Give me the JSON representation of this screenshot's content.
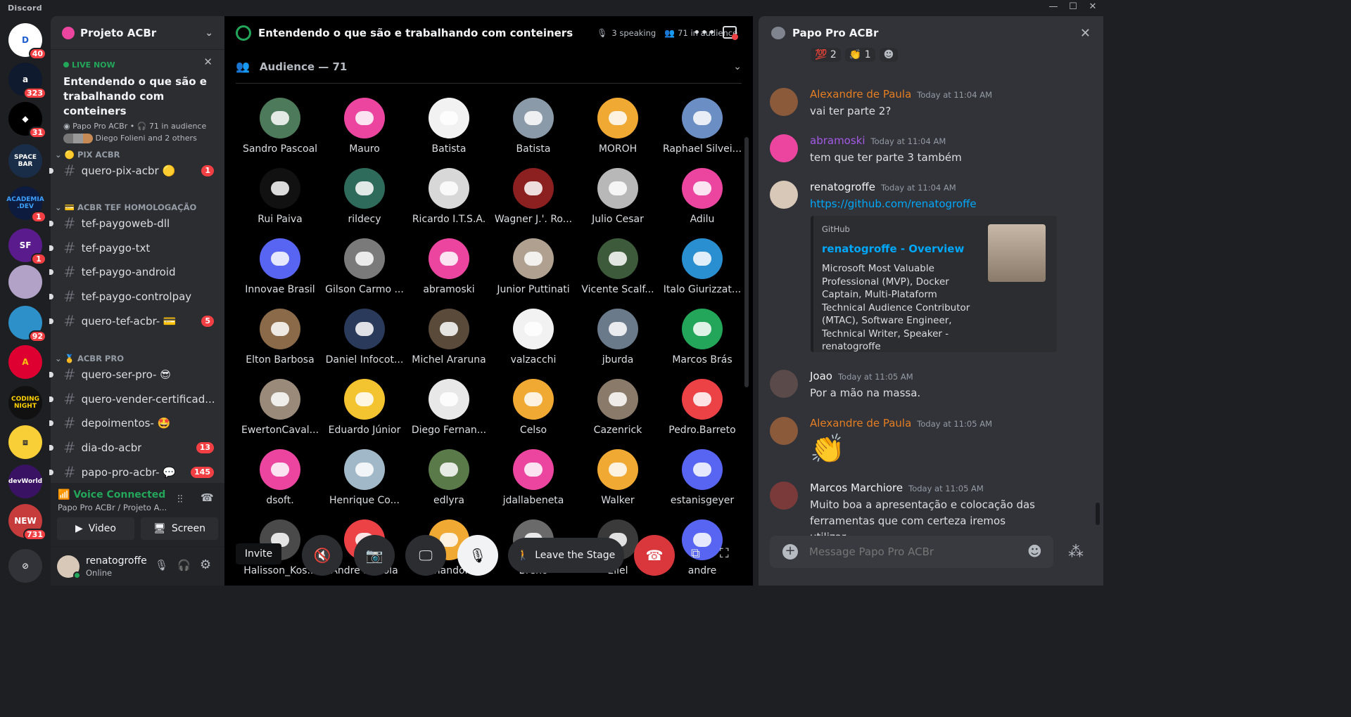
{
  "app": {
    "title": "Discord"
  },
  "servers": [
    {
      "initials": "D",
      "badge": "40",
      "color": "#ffffff",
      "fg": "#1d5fcf"
    },
    {
      "initials": "a",
      "badge": "323",
      "color": "#0f1a2e",
      "fg": "#ffffff"
    },
    {
      "initials": "◆",
      "badge": "31",
      "color": "#000000",
      "fg": "#ffffff"
    },
    {
      "initials": "SPACE BAR",
      "badge": "",
      "color": "#1a2d48",
      "fg": "#ffffff"
    },
    {
      "initials": "ACADEMIA .DEV",
      "badge": "1",
      "color": "#0d1b3e",
      "fg": "#3ca0ff"
    },
    {
      "initials": "SF",
      "badge": "1",
      "color": "#5a1c8c",
      "fg": "#ffffff"
    },
    {
      "initials": "",
      "badge": "",
      "color": "#b2a2c8",
      "fg": "#ffffff"
    },
    {
      "initials": "",
      "badge": "92",
      "color": "#2e90c8",
      "fg": "#ffffff"
    },
    {
      "initials": "A",
      "badge": "",
      "color": "#dd0031",
      "fg": "#f6c20f"
    },
    {
      "initials": "CODING NIGHT",
      "badge": "",
      "color": "#111111",
      "fg": "#ffd200"
    },
    {
      "initials": "⧈",
      "badge": "",
      "color": "#f9cf37",
      "fg": "#333333"
    },
    {
      "initials": "devWorld",
      "badge": "",
      "color": "#3a1264",
      "fg": "#ffffff"
    },
    {
      "initials": "NEW",
      "badge": "731",
      "color": "#c63b3b",
      "fg": "#ffffff"
    }
  ],
  "sidebar": {
    "server_name": "Projeto ACBr",
    "live": {
      "tag": "LIVE NOW",
      "title": "Entendendo o que são e trabalhando com conteiners",
      "host": "Papo Pro ACBr",
      "audience": "71 in audience",
      "speakers": "Diego Folieni and 2 others"
    },
    "categories": [
      {
        "label": "🟡 PIX ACBR",
        "channels": [
          {
            "name": "quero-pix-acbr 🟡",
            "count": "1"
          }
        ]
      },
      {
        "label": "💳 ACBR TEF HOMOLOGAÇÃO",
        "channels": [
          {
            "name": "tef-paygoweb-dll",
            "count": ""
          },
          {
            "name": "tef-paygo-txt",
            "count": ""
          },
          {
            "name": "tef-paygo-android",
            "count": ""
          },
          {
            "name": "tef-paygo-controlpay",
            "count": ""
          },
          {
            "name": "quero-tef-acbr- 💳",
            "count": "5"
          }
        ]
      },
      {
        "label": "🥇 ACBR PRO",
        "channels": [
          {
            "name": "quero-ser-pro- 😎",
            "count": ""
          },
          {
            "name": "quero-vender-certificad...",
            "count": ""
          },
          {
            "name": "depoimentos- 🤩",
            "count": ""
          },
          {
            "name": "dia-do-acbr",
            "count": "13"
          },
          {
            "name": "papo-pro-acbr- 💬",
            "count": "145"
          }
        ]
      }
    ],
    "voice": {
      "status": "Voice Connected",
      "location": "Papo Pro ACBr / Projeto A...",
      "video": "Video",
      "screen": "Screen"
    },
    "user": {
      "name": "renatogroffe",
      "status": "Online"
    }
  },
  "stage": {
    "title": "Entendendo o que são e trabalhando com conteiners",
    "speaking": "3 speaking",
    "audience_count": "71 in audience",
    "audience_header": "Audience — 71",
    "members": [
      {
        "name": "Sandro Pascoal",
        "color": "#4d7a5a"
      },
      {
        "name": "Mauro",
        "color": "#eb459f"
      },
      {
        "name": "Batista",
        "color": "#f2f2f2"
      },
      {
        "name": "Batista",
        "color": "#8a9aa8"
      },
      {
        "name": "MOROH",
        "color": "#f0a932"
      },
      {
        "name": "Raphael Silvei...",
        "color": "#6b8fc4"
      },
      {
        "name": "Rui Paiva",
        "color": "#111111"
      },
      {
        "name": "rildecy",
        "color": "#2e6b5a"
      },
      {
        "name": "Ricardo I.T.S.A.",
        "color": "#d8d8d8"
      },
      {
        "name": "Wagner J.'. Ro...",
        "color": "#8c1f1f"
      },
      {
        "name": "Julio Cesar",
        "color": "#b8b8b8"
      },
      {
        "name": "Adilu",
        "color": "#eb459f"
      },
      {
        "name": "Innovae Brasil",
        "color": "#5865f2"
      },
      {
        "name": "Gilson Carmo ...",
        "color": "#7a7a7a"
      },
      {
        "name": "abramoski",
        "color": "#eb459f"
      },
      {
        "name": "Junior Puttinati",
        "color": "#b0a090"
      },
      {
        "name": "Vicente Scalf...",
        "color": "#3d5a3a"
      },
      {
        "name": "Italo Giurizzat...",
        "color": "#2a8fd0"
      },
      {
        "name": "Elton Barbosa",
        "color": "#8a6a48"
      },
      {
        "name": "Daniel Infocot...",
        "color": "#2a3a5a"
      },
      {
        "name": "Michel Araruna",
        "color": "#5a4a3a"
      },
      {
        "name": "valzacchi",
        "color": "#f2f2f2"
      },
      {
        "name": "jburda",
        "color": "#6a7a8a"
      },
      {
        "name": "Marcos Brás",
        "color": "#23a55a"
      },
      {
        "name": "EwertonCaval...",
        "color": "#9a8a7a"
      },
      {
        "name": "Eduardo Júnior",
        "color": "#f4c430"
      },
      {
        "name": "Diego Fernan...",
        "color": "#e8e8e8"
      },
      {
        "name": "Celso",
        "color": "#f0a932"
      },
      {
        "name": "Cazenrick",
        "color": "#8a7a6a"
      },
      {
        "name": "Pedro.Barreto",
        "color": "#ed4245"
      },
      {
        "name": "dsoft.",
        "color": "#eb459f"
      },
      {
        "name": "Henrique Co...",
        "color": "#a0b8c8"
      },
      {
        "name": "edlyra",
        "color": "#5a7a4a"
      },
      {
        "name": "jdallabeneta",
        "color": "#eb459f"
      },
      {
        "name": "Walker",
        "color": "#f0a932"
      },
      {
        "name": "estanisgeyer",
        "color": "#5865f2"
      },
      {
        "name": "Halisson_Kos...",
        "color": "#4a4a4a"
      },
      {
        "name": "Andre Sterola",
        "color": "#ed4245"
      },
      {
        "name": "FernandoMF",
        "color": "#f0a932"
      },
      {
        "name": "Breno",
        "color": "#6a6a6a"
      },
      {
        "name": "Eliel",
        "color": "#3a3a3a"
      },
      {
        "name": "andre",
        "color": "#5865f2"
      }
    ],
    "controls": {
      "invite": "Invite",
      "leave": "Leave the Stage"
    }
  },
  "chat": {
    "channel": "Papo Pro ACBr",
    "reactions": [
      {
        "emoji": "💯",
        "count": "2"
      },
      {
        "emoji": "👏",
        "count": "1"
      }
    ],
    "messages": [
      {
        "author": "Alexandre de Paula",
        "color": "#e67e22",
        "time": "Today at 11:04 AM",
        "text": "vai ter parte 2?",
        "avatar": "#8a5a3a"
      },
      {
        "author": "abramoski",
        "color": "#a55ae6",
        "time": "Today at 11:04 AM",
        "text": "tem que ter parte 3 também",
        "avatar": "#eb459f"
      },
      {
        "author": "renatogroffe",
        "color": "#f2f3f5",
        "time": "Today at 11:04 AM",
        "text": "https://github.com/renatogroffe",
        "avatar": "#d8c8b8"
      },
      {
        "author": "Joao",
        "color": "#f2f3f5",
        "time": "Today at 11:05 AM",
        "text": "Por a mão na massa.",
        "avatar": "#5a4a4a"
      },
      {
        "author": "Alexandre de Paula",
        "color": "#e67e22",
        "time": "Today at 11:05 AM",
        "text": "👏",
        "avatar": "#8a5a3a"
      },
      {
        "author": "Marcos Marchiore",
        "color": "#f2f3f5",
        "time": "Today at 11:05 AM",
        "text": "Muito boa a apresentação e colocação das ferramentas que com certeza iremos utilizar.",
        "avatar": "#7a3a3a"
      }
    ],
    "embed": {
      "provider": "GitHub",
      "title": "renatogroffe - Overview",
      "description": "Microsoft Most Valuable Professional (MVP), Docker Captain, Multi-Plataform Technical Audience Contributor (MTAC), Software Engineer, Technical Writer, Speaker - renatogroffe"
    },
    "composer_placeholder": "Message Papo Pro ACBr"
  }
}
